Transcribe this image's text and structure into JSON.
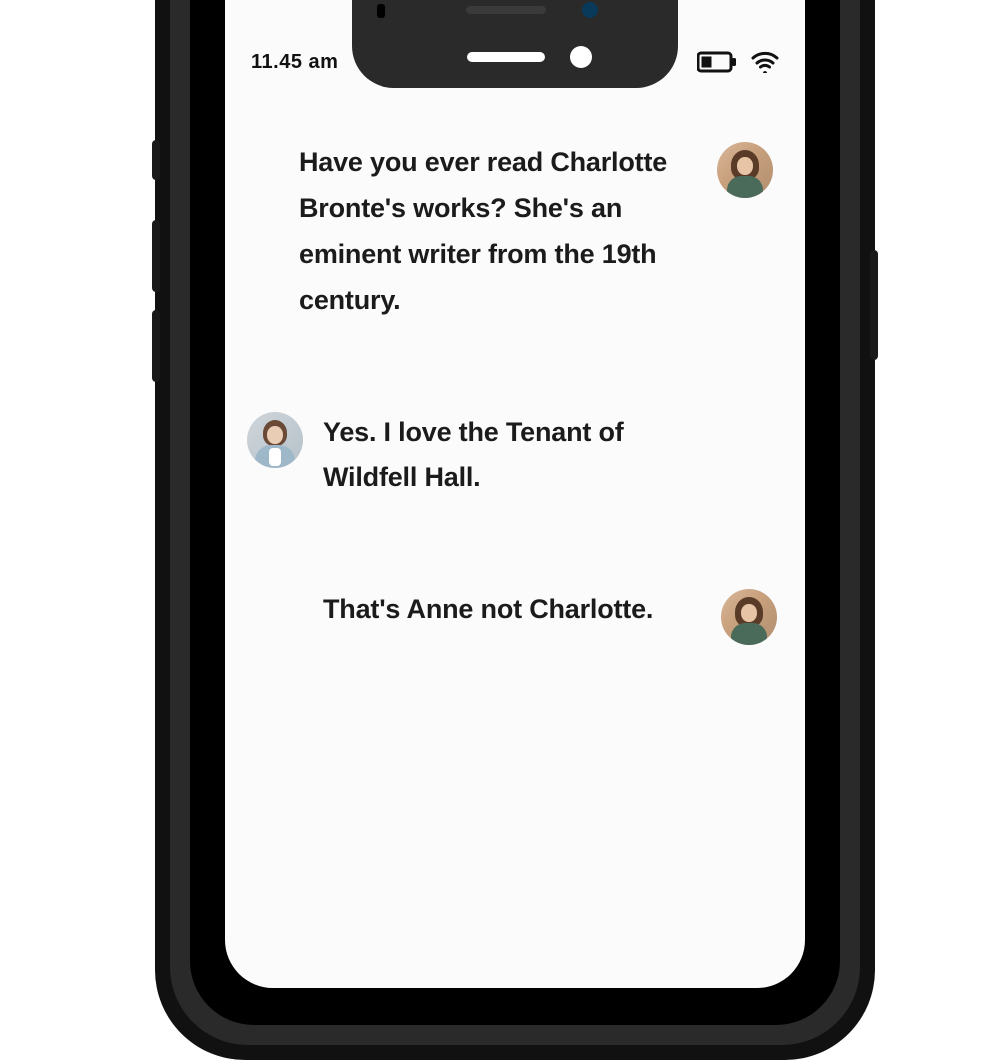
{
  "status": {
    "time": "11.45 am"
  },
  "messages": [
    {
      "sender": "a",
      "side": "right",
      "text": "Have you ever read Charlotte Bronte's works? She's an eminent writer from the 19th century."
    },
    {
      "sender": "b",
      "side": "left",
      "text": "Yes. I love the Tenant of Wildfell Hall."
    },
    {
      "sender": "a",
      "side": "right",
      "text": "That's Anne not Charlotte."
    }
  ]
}
